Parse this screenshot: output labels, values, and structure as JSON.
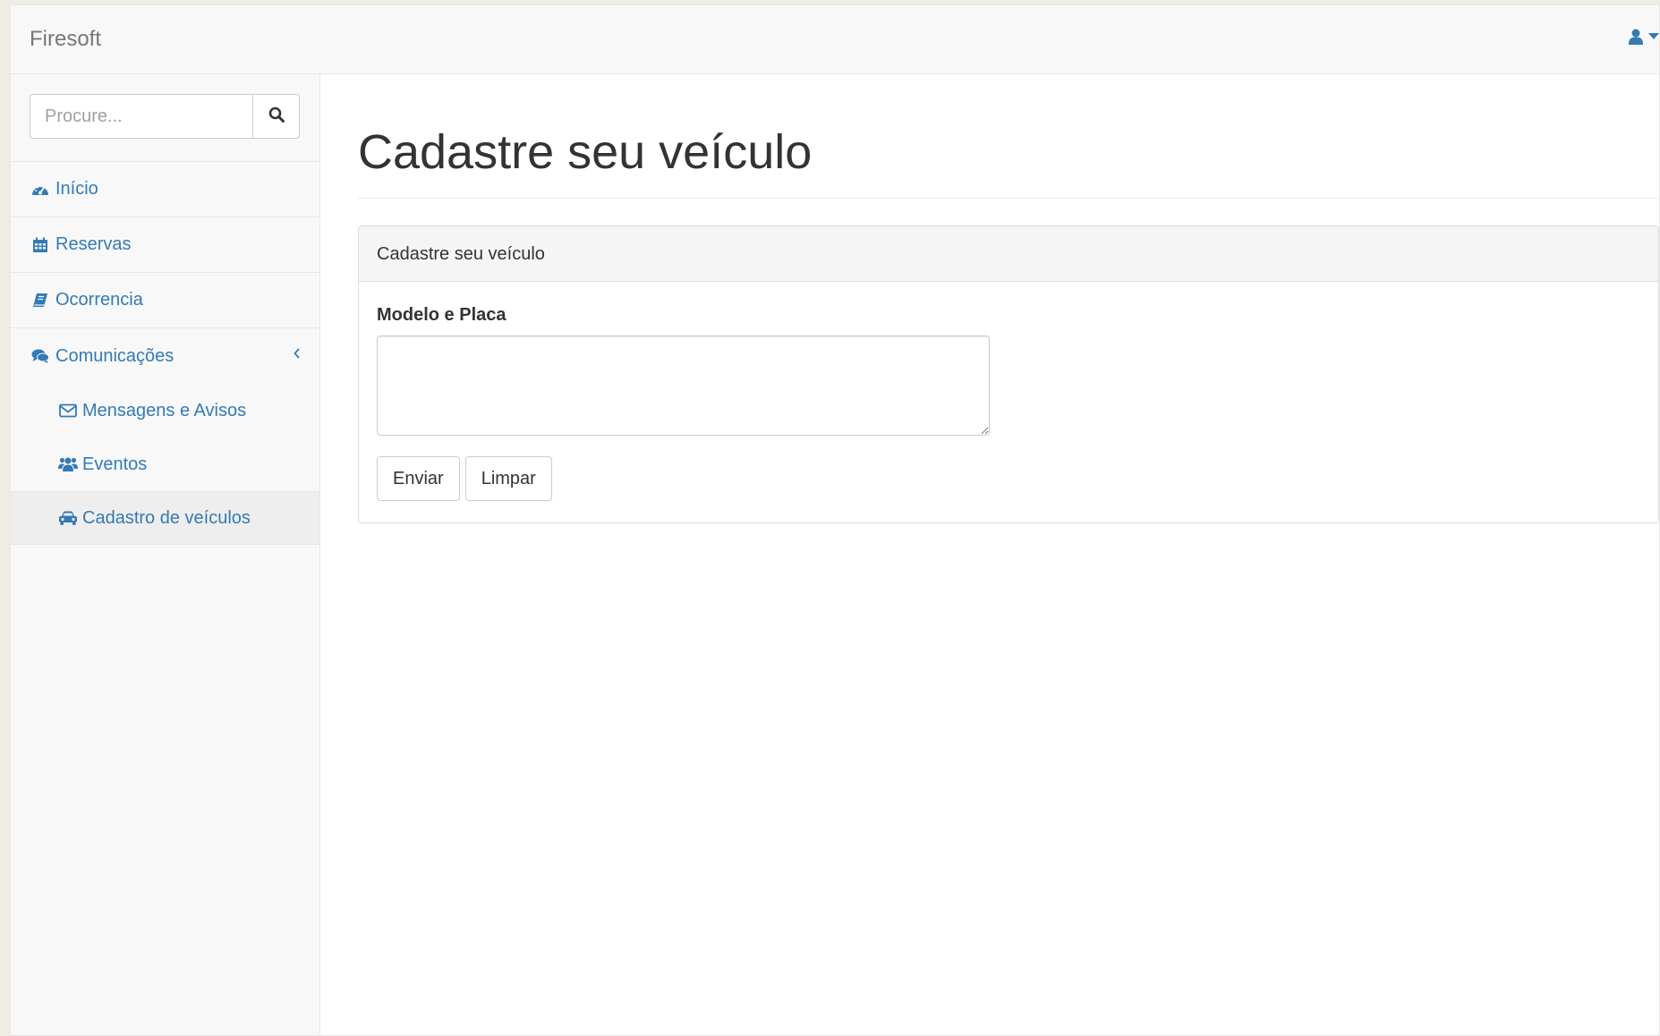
{
  "app": {
    "brand": "Firesoft",
    "accent_color": "#337ab7"
  },
  "navbar": {
    "user_icon": "user-icon",
    "caret_icon": "caret-down-icon"
  },
  "sidebar": {
    "search": {
      "placeholder": "Procure...",
      "value": "",
      "icon": "search-icon"
    },
    "items": [
      {
        "label": "Início",
        "icon": "dashboard-icon"
      },
      {
        "label": "Reservas",
        "icon": "calendar-icon"
      },
      {
        "label": "Ocorrencia",
        "icon": "book-icon"
      },
      {
        "label": "Comunicações",
        "icon": "comments-icon",
        "expanded": true
      }
    ],
    "sub_items": [
      {
        "label": "Mensagens e Avisos",
        "icon": "envelope-icon",
        "active": false
      },
      {
        "label": "Eventos",
        "icon": "users-icon",
        "active": false
      },
      {
        "label": "Cadastro de veículos",
        "icon": "car-icon",
        "active": true
      }
    ]
  },
  "main": {
    "page_title": "Cadastre seu veículo",
    "panel": {
      "heading": "Cadastre seu veículo",
      "field_label": "Modelo e Placa",
      "field_value": "",
      "submit_label": "Enviar",
      "reset_label": "Limpar"
    }
  }
}
